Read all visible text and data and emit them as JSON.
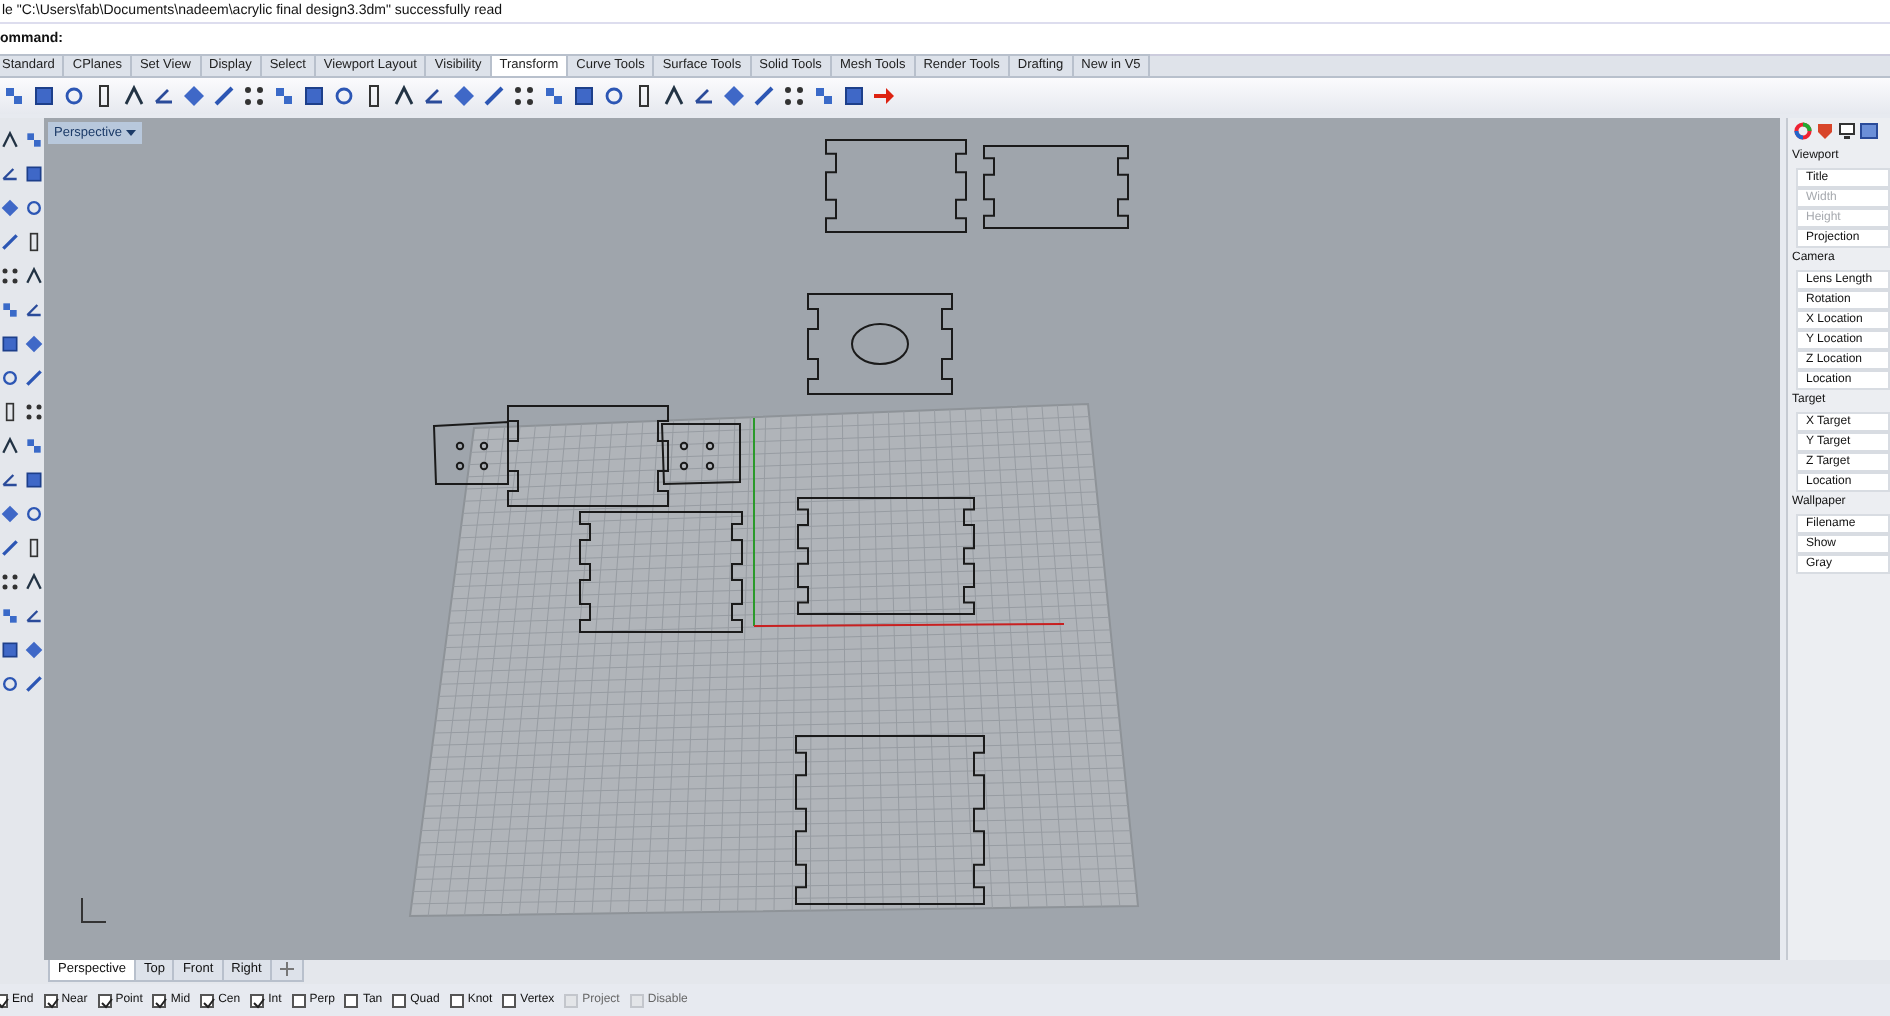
{
  "history_line": "le \"C:\\Users\\fab\\Documents\\nadeem\\acrylic final design3.3dm\" successfully read",
  "command": {
    "label": "ommand:"
  },
  "toolbar_tabs": [
    {
      "label": "Standard",
      "selected": false
    },
    {
      "label": "CPlanes",
      "selected": false
    },
    {
      "label": "Set View",
      "selected": false
    },
    {
      "label": "Display",
      "selected": false
    },
    {
      "label": "Select",
      "selected": false
    },
    {
      "label": "Viewport Layout",
      "selected": false
    },
    {
      "label": "Visibility",
      "selected": false
    },
    {
      "label": "Transform",
      "selected": true
    },
    {
      "label": "Curve Tools",
      "selected": false
    },
    {
      "label": "Surface Tools",
      "selected": false
    },
    {
      "label": "Solid Tools",
      "selected": false
    },
    {
      "label": "Mesh Tools",
      "selected": false
    },
    {
      "label": "Render Tools",
      "selected": false
    },
    {
      "label": "Drafting",
      "selected": false
    },
    {
      "label": "New in V5",
      "selected": false
    }
  ],
  "viewport": {
    "title": "Perspective"
  },
  "viewport_tabs": [
    {
      "label": "Perspective",
      "selected": true
    },
    {
      "label": "Top",
      "selected": false
    },
    {
      "label": "Front",
      "selected": false
    },
    {
      "label": "Right",
      "selected": false
    }
  ],
  "properties": {
    "sections": [
      {
        "title": "Viewport",
        "rows": [
          {
            "label": "Title",
            "disabled": false
          },
          {
            "label": "Width",
            "disabled": true
          },
          {
            "label": "Height",
            "disabled": true
          },
          {
            "label": "Projection",
            "disabled": false
          }
        ]
      },
      {
        "title": "Camera",
        "rows": [
          {
            "label": "Lens Length",
            "disabled": false
          },
          {
            "label": "Rotation",
            "disabled": false
          },
          {
            "label": "X Location",
            "disabled": false
          },
          {
            "label": "Y Location",
            "disabled": false
          },
          {
            "label": "Z Location",
            "disabled": false
          },
          {
            "label": "Location",
            "disabled": false
          }
        ]
      },
      {
        "title": "Target",
        "rows": [
          {
            "label": "X Target",
            "disabled": false
          },
          {
            "label": "Y Target",
            "disabled": false
          },
          {
            "label": "Z Target",
            "disabled": false
          },
          {
            "label": "Location",
            "disabled": false
          }
        ]
      },
      {
        "title": "Wallpaper",
        "rows": [
          {
            "label": "Filename",
            "disabled": false
          },
          {
            "label": "Show",
            "disabled": false
          },
          {
            "label": "Gray",
            "disabled": false
          }
        ]
      }
    ]
  },
  "osnaps": [
    {
      "label": "End",
      "checked": true,
      "disabled": false
    },
    {
      "label": "Near",
      "checked": true,
      "disabled": false
    },
    {
      "label": "Point",
      "checked": true,
      "disabled": false
    },
    {
      "label": "Mid",
      "checked": true,
      "disabled": false
    },
    {
      "label": "Cen",
      "checked": true,
      "disabled": false
    },
    {
      "label": "Int",
      "checked": true,
      "disabled": false
    },
    {
      "label": "Perp",
      "checked": false,
      "disabled": false
    },
    {
      "label": "Tan",
      "checked": false,
      "disabled": false
    },
    {
      "label": "Quad",
      "checked": false,
      "disabled": false
    },
    {
      "label": "Knot",
      "checked": false,
      "disabled": false
    },
    {
      "label": "Vertex",
      "checked": false,
      "disabled": false
    },
    {
      "label": "Project",
      "checked": false,
      "disabled": true
    },
    {
      "label": "Disable",
      "checked": false,
      "disabled": true
    }
  ]
}
